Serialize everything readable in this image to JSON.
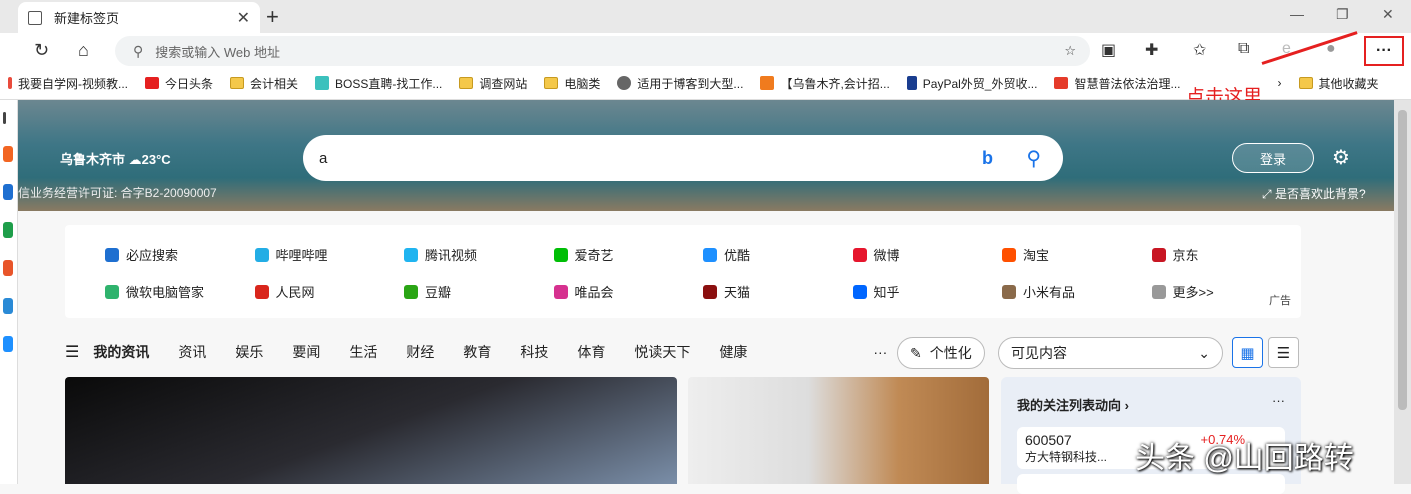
{
  "tab": {
    "title": "新建标签页"
  },
  "omnibox": {
    "placeholder": "搜索或输入 Web 地址"
  },
  "bookmarks": [
    {
      "label": "我要自学网-视频教...",
      "color": "#e94b3c"
    },
    {
      "label": "今日头条",
      "color": "#e52020"
    },
    {
      "label": "会计相关",
      "color": "folder"
    },
    {
      "label": "BOSS直聘-找工作...",
      "color": "#3cc1bd"
    },
    {
      "label": "调查网站",
      "color": "folder"
    },
    {
      "label": "电脑类",
      "color": "folder"
    },
    {
      "label": "适用于博客到大型...",
      "color": "#666666"
    },
    {
      "label": "【乌鲁木齐,会计招...",
      "color": "#f07b1e"
    },
    {
      "label": "PayPal外贸_外贸收...",
      "color": "#1a3d8f"
    },
    {
      "label": "智慧普法依法治理...",
      "color": "#e53b2a"
    }
  ],
  "other_bookmarks": "其他收藏夹",
  "annotation": "点击这里",
  "weather": {
    "city": "乌鲁木齐市",
    "temp": "23°C"
  },
  "license": "信业务经营许可证: 合字B2-20090007",
  "search": {
    "value": "a"
  },
  "login": "登录",
  "like_bg": "是否喜欢此背景?",
  "quick_links": [
    {
      "label": "必应搜索",
      "color": "#1e6fd0"
    },
    {
      "label": "哔哩哔哩",
      "color": "#23ade5"
    },
    {
      "label": "腾讯视频",
      "color": "#20b4f0"
    },
    {
      "label": "爱奇艺",
      "color": "#00be06"
    },
    {
      "label": "优酷",
      "color": "#1e90ff"
    },
    {
      "label": "微博",
      "color": "#e6162d"
    },
    {
      "label": "淘宝",
      "color": "#ff5000"
    },
    {
      "label": "京东",
      "color": "#c81623"
    },
    {
      "label": "微软电脑管家",
      "color": "#2fb36d"
    },
    {
      "label": "人民网",
      "color": "#d9261c"
    },
    {
      "label": "豆瓣",
      "color": "#2aa515"
    },
    {
      "label": "唯品会",
      "color": "#d6318f"
    },
    {
      "label": "天猫",
      "color": "#8b0f0f"
    },
    {
      "label": "知乎",
      "color": "#0066ff"
    },
    {
      "label": "小米有品",
      "color": "#8a6a4a"
    },
    {
      "label": "更多>>",
      "color": "#999999"
    }
  ],
  "ad": "广告",
  "news_nav": [
    "我的资讯",
    "资讯",
    "娱乐",
    "要闻",
    "生活",
    "财经",
    "教育",
    "科技",
    "体育",
    "悦读天下",
    "健康"
  ],
  "more_nav": "···",
  "personalize": "个性化",
  "visible_content": "可见内容",
  "watchlist": {
    "title": "我的关注列表动向",
    "code": "600507",
    "name": "方大特钢科技...",
    "change": "+0.74%"
  },
  "watermark": "头条 @山回路转"
}
